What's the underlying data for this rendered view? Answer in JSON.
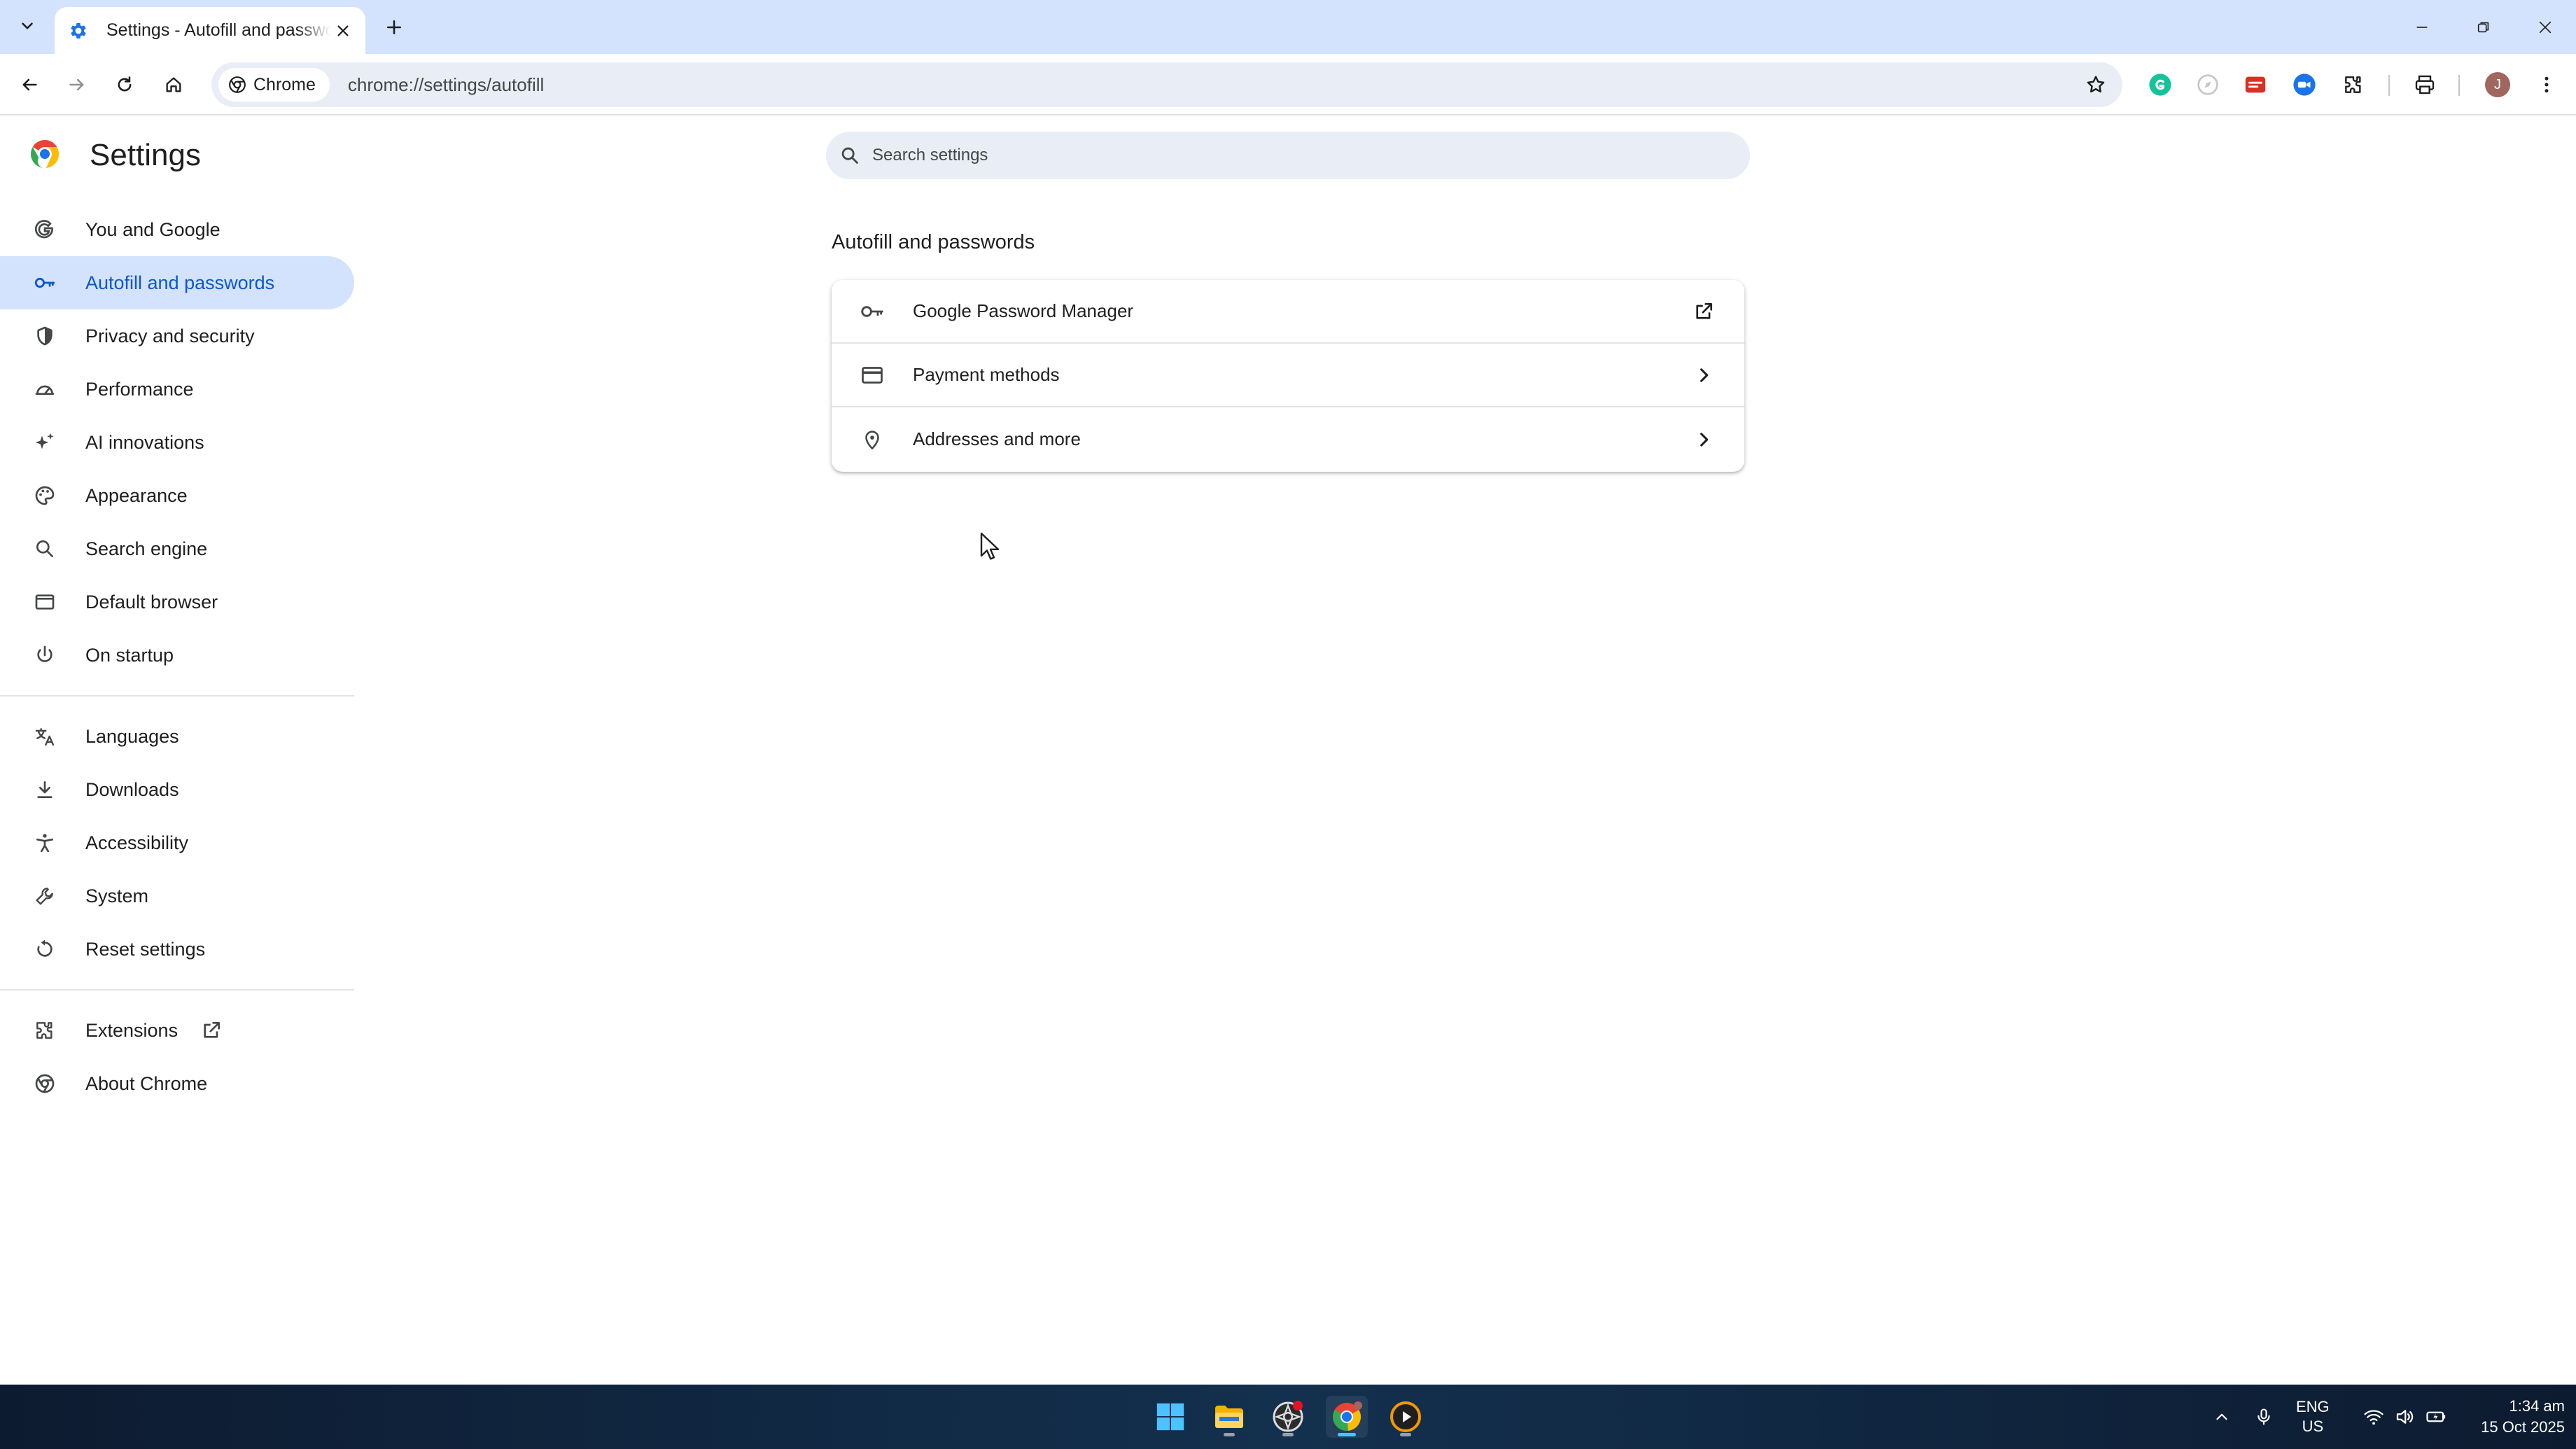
{
  "browser": {
    "tab_title": "Settings - Autofill and passwords",
    "chip_label": "Chrome",
    "url": "chrome://settings/autofill",
    "profile_initial": "J"
  },
  "settings": {
    "title": "Settings",
    "search_placeholder": "Search settings"
  },
  "sidebar": {
    "group1": [
      {
        "label": "You and Google",
        "icon": "google-g-icon"
      },
      {
        "label": "Autofill and passwords",
        "icon": "key-icon",
        "active": true
      },
      {
        "label": "Privacy and security",
        "icon": "shield-icon"
      },
      {
        "label": "Performance",
        "icon": "speedometer-icon"
      },
      {
        "label": "AI innovations",
        "icon": "sparkle-icon"
      },
      {
        "label": "Appearance",
        "icon": "palette-icon"
      },
      {
        "label": "Search engine",
        "icon": "search-icon"
      },
      {
        "label": "Default browser",
        "icon": "browser-window-icon"
      },
      {
        "label": "On startup",
        "icon": "power-icon"
      }
    ],
    "group2": [
      {
        "label": "Languages",
        "icon": "translate-icon"
      },
      {
        "label": "Downloads",
        "icon": "download-icon"
      },
      {
        "label": "Accessibility",
        "icon": "accessibility-icon"
      },
      {
        "label": "System",
        "icon": "wrench-icon"
      },
      {
        "label": "Reset settings",
        "icon": "reset-icon"
      }
    ],
    "group3": [
      {
        "label": "Extensions",
        "icon": "puzzle-icon"
      },
      {
        "label": "About Chrome",
        "icon": "chrome-icon"
      }
    ]
  },
  "main": {
    "section_title": "Autofill and passwords",
    "rows": [
      {
        "label": "Google Password Manager",
        "icon": "key-icon",
        "action": "open-in-new-icon"
      },
      {
        "label": "Payment methods",
        "icon": "credit-card-icon",
        "action": "chevron-right-icon"
      },
      {
        "label": "Addresses and more",
        "icon": "location-pin-icon",
        "action": "chevron-right-icon"
      }
    ]
  },
  "taskbar": {
    "lang_line1": "ENG",
    "lang_line2": "US",
    "time": "1:34 am",
    "date": "15 Oct 2025"
  },
  "colors": {
    "accent": "#0b57d0",
    "active_nav_bg": "#d3e3fd",
    "tabstrip_bg": "#d3e3fd",
    "omnibox_bg": "#e9eef6"
  }
}
